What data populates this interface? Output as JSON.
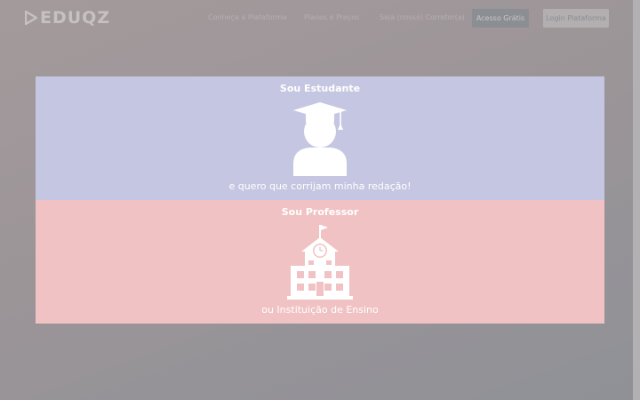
{
  "header": {
    "logo_text": "EDUQZ",
    "nav": [
      {
        "label": "Conheça a Plataforma"
      },
      {
        "label": "Planos e Preços"
      },
      {
        "label": "Seja (nosso) Corretor(a)"
      }
    ],
    "primary_button": "Acesso Grátis",
    "secondary_button": "Login Plataforma"
  },
  "options": [
    {
      "title": "Sou Estudante",
      "subtitle": "e quero que corrijam minha redação!",
      "icon": "graduate-icon",
      "color": "#c5c6e1"
    },
    {
      "title": "Sou Professor",
      "subtitle": "ou Instituição de Ensino",
      "icon": "school-building-icon",
      "color": "#f0c2c3"
    }
  ]
}
